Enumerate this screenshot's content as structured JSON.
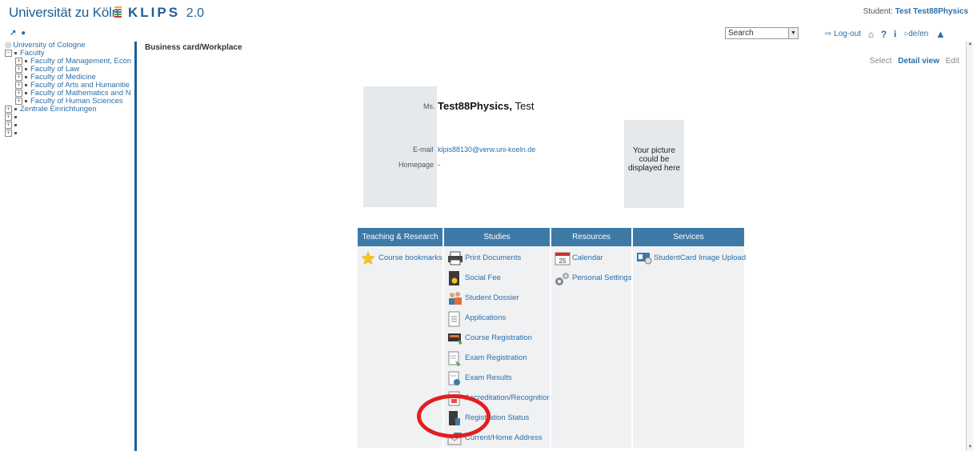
{
  "header": {
    "brand": "Universität zu Köln",
    "brand_colors": [
      "#e8b23a",
      "#d4663a",
      "#3d7aa8",
      "#5aa04c",
      "#c23b3b"
    ],
    "product": "KLIPS",
    "version": "2.0",
    "student_label": "Student:",
    "student_name": "Test Test88Physics"
  },
  "toolbar": {
    "icons": [
      "open-window-icon",
      "refresh-icon"
    ],
    "search_value": "Search",
    "logout_label": "Log-out",
    "lang_label": "de/en"
  },
  "sidebar": {
    "root": "University of Cologne",
    "items": [
      {
        "label": "Faculty",
        "level": 0
      },
      {
        "label": "Faculty of Management, Econ",
        "level": 1
      },
      {
        "label": "Faculty of Law",
        "level": 1
      },
      {
        "label": "Faculty of Medicine",
        "level": 1
      },
      {
        "label": "Faculty of Arts and Humanitie",
        "level": 1
      },
      {
        "label": "Faculty of Mathematics and N",
        "level": 1
      },
      {
        "label": "Faculty of Human Sciences",
        "level": 1
      },
      {
        "label": "Zentrale Einrichtungen",
        "level": 0
      },
      {
        "label": "",
        "level": 0
      },
      {
        "label": "",
        "level": 0
      },
      {
        "label": "",
        "level": 0
      }
    ]
  },
  "main": {
    "breadcrumb": "Business card/Workplace",
    "view_select": "Select",
    "view_detail": "Detail view",
    "view_edit": "Edit",
    "card": {
      "salutation": "Ms.",
      "surname": "Test88Physics,",
      "firstname": "Test",
      "email_label": "E-mail",
      "email": "klpis88130@verw.uni-koeln.de",
      "homepage_label": "Homepage",
      "homepage": "-"
    },
    "picture_text": "Your picture could be displayed here"
  },
  "menu": {
    "columns": [
      {
        "title": "Teaching & Research",
        "items": [
          {
            "label": "Course bookmarks",
            "icon": "star-icon"
          }
        ]
      },
      {
        "title": "Studies",
        "items": [
          {
            "label": "Print Documents",
            "icon": "printer-icon"
          },
          {
            "label": "Social Fee",
            "icon": "fee-icon"
          },
          {
            "label": "Student Dossier",
            "icon": "people-icon"
          },
          {
            "label": "Applications",
            "icon": "document-icon"
          },
          {
            "label": "Course Registration",
            "icon": "course-icon"
          },
          {
            "label": "Exam Registration",
            "icon": "exam-icon"
          },
          {
            "label": "Exam Results",
            "icon": "results-icon"
          },
          {
            "label": "Accreditation/Recognition",
            "icon": "accreditation-icon"
          },
          {
            "label": "Registration Status",
            "icon": "status-icon"
          },
          {
            "label": "Current/Home Address",
            "icon": "address-icon"
          }
        ]
      },
      {
        "title": "Resources",
        "items": [
          {
            "label": "Calendar",
            "icon": "calendar-icon"
          },
          {
            "label": "Personal Settings",
            "icon": "gear-icon"
          }
        ]
      },
      {
        "title": "Services",
        "items": [
          {
            "label": "StudentCard Image Upload",
            "icon": "upload-icon"
          }
        ]
      }
    ]
  },
  "annotation": {
    "color": "#e41e1e"
  }
}
